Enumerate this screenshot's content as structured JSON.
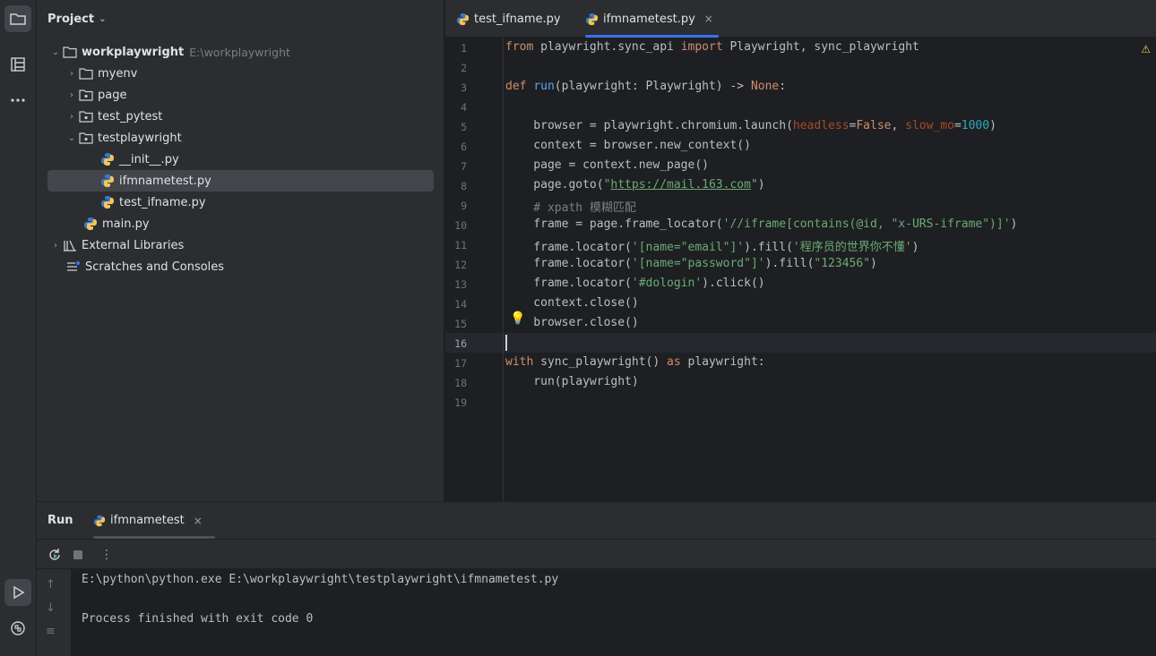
{
  "project_panel": {
    "title": "Project",
    "tree": [
      {
        "label": "workplaywright",
        "path": "E:\\workplaywright",
        "level": 0,
        "expanded": true,
        "icon": "folder-icon"
      },
      {
        "label": "myenv",
        "level": 1,
        "expanded": false,
        "icon": "folder-icon"
      },
      {
        "label": "page",
        "level": 1,
        "expanded": false,
        "icon": "package-icon"
      },
      {
        "label": "test_pytest",
        "level": 1,
        "expanded": false,
        "icon": "package-icon"
      },
      {
        "label": "testplaywright",
        "level": 1,
        "expanded": true,
        "icon": "package-icon"
      },
      {
        "label": "__init__.py",
        "level": 2,
        "icon": "python-icon"
      },
      {
        "label": "ifmnametest.py",
        "level": 2,
        "icon": "python-icon",
        "selected": true
      },
      {
        "label": "test_ifname.py",
        "level": 2,
        "icon": "python-icon"
      },
      {
        "label": "main.py",
        "level": 1,
        "icon": "python-icon"
      },
      {
        "label": "External Libraries",
        "level": 0,
        "expanded": false,
        "icon": "library-icon"
      },
      {
        "label": "Scratches and Consoles",
        "level": 0,
        "icon": "scratches-icon"
      }
    ]
  },
  "editor": {
    "tabs": [
      {
        "label": "test_ifname.py",
        "active": false
      },
      {
        "label": "ifmnametest.py",
        "active": true,
        "close": "×"
      }
    ],
    "current_line": 16,
    "line_numbers": [
      "1",
      "2",
      "3",
      "4",
      "5",
      "6",
      "7",
      "8",
      "9",
      "10",
      "11",
      "12",
      "13",
      "14",
      "15",
      "16",
      "17",
      "18",
      "19"
    ]
  },
  "run_panel": {
    "title": "Run",
    "tab_label": "ifmnametest",
    "tab_close": "×",
    "output": [
      "E:\\python\\python.exe E:\\workplaywright\\testplaywright\\ifmnametest.py",
      "",
      "Process finished with exit code 0"
    ]
  },
  "colors": {
    "accent": "#3574f0",
    "keyword": "#cf8e6d",
    "string": "#6aab73",
    "function": "#56a8f5",
    "number": "#2aacb8",
    "comment": "#7a7e85"
  }
}
